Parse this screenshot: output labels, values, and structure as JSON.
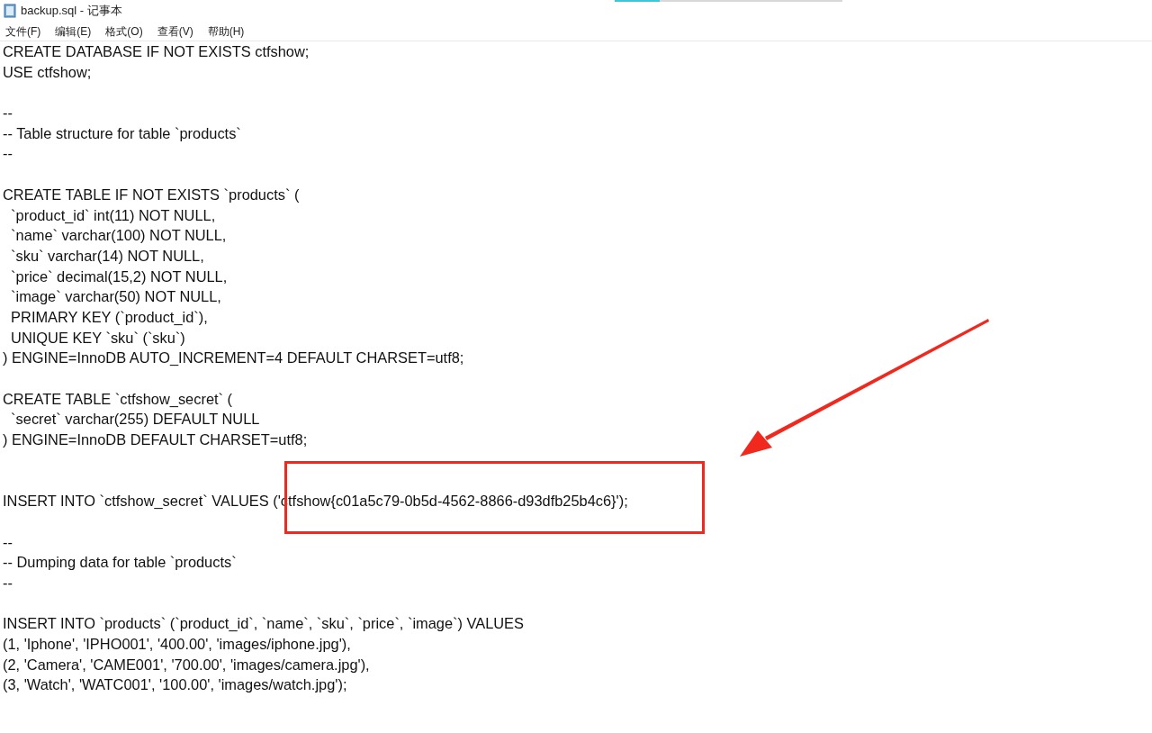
{
  "window": {
    "title": "backup.sql - 记事本"
  },
  "menu": [
    {
      "label": "文件(F)"
    },
    {
      "label": "编辑(E)"
    },
    {
      "label": "格式(O)"
    },
    {
      "label": "查看(V)"
    },
    {
      "label": "帮助(H)"
    }
  ],
  "lines": [
    {
      "kind": "text",
      "text": "CREATE DATABASE IF NOT EXISTS ctfshow;"
    },
    {
      "kind": "text",
      "text": "USE ctfshow;"
    },
    {
      "kind": "blank"
    },
    {
      "kind": "text",
      "text": "--"
    },
    {
      "kind": "text",
      "text": "-- Table structure for table `products`"
    },
    {
      "kind": "text",
      "text": "--"
    },
    {
      "kind": "blank"
    },
    {
      "kind": "text",
      "text": "CREATE TABLE IF NOT EXISTS `products` ("
    },
    {
      "kind": "text",
      "text": "  `product_id` int(11) NOT NULL,"
    },
    {
      "kind": "text",
      "text": "  `name` varchar(100) NOT NULL,"
    },
    {
      "kind": "text",
      "text": "  `sku` varchar(14) NOT NULL,"
    },
    {
      "kind": "text",
      "text": "  `price` decimal(15,2) NOT NULL,"
    },
    {
      "kind": "text",
      "text": "  `image` varchar(50) NOT NULL,"
    },
    {
      "kind": "text",
      "text": "  PRIMARY KEY (`product_id`),"
    },
    {
      "kind": "text",
      "text": "  UNIQUE KEY `sku` (`sku`)"
    },
    {
      "kind": "text",
      "text": ") ENGINE=InnoDB AUTO_INCREMENT=4 DEFAULT CHARSET=utf8;"
    },
    {
      "kind": "blank"
    },
    {
      "kind": "text",
      "text": "CREATE TABLE `ctfshow_secret` ("
    },
    {
      "kind": "text",
      "text": "  `secret` varchar(255) DEFAULT NULL"
    },
    {
      "kind": "text",
      "text": ") ENGINE=InnoDB DEFAULT CHARSET=utf8;"
    },
    {
      "kind": "blank"
    },
    {
      "kind": "blank"
    },
    {
      "kind": "text",
      "text": "INSERT INTO `ctfshow_secret` VALUES ('ctfshow{c01a5c79-0b5d-4562-8866-d93dfb25b4c6}');"
    },
    {
      "kind": "blank"
    },
    {
      "kind": "text",
      "text": "--"
    },
    {
      "kind": "text",
      "text": "-- Dumping data for table `products`"
    },
    {
      "kind": "text",
      "text": "--"
    },
    {
      "kind": "blank"
    },
    {
      "kind": "text",
      "text": "INSERT INTO `products` (`product_id`, `name`, `sku`, `price`, `image`) VALUES"
    },
    {
      "kind": "text",
      "text": "(1, 'Iphone', 'IPHO001', '400.00', 'images/iphone.jpg'),"
    },
    {
      "kind": "text",
      "text": "(2, 'Camera', 'CAME001', '700.00', 'images/camera.jpg'),"
    },
    {
      "kind": "text",
      "text": "(3, 'Watch', 'WATC001', '100.00', 'images/watch.jpg');"
    }
  ]
}
